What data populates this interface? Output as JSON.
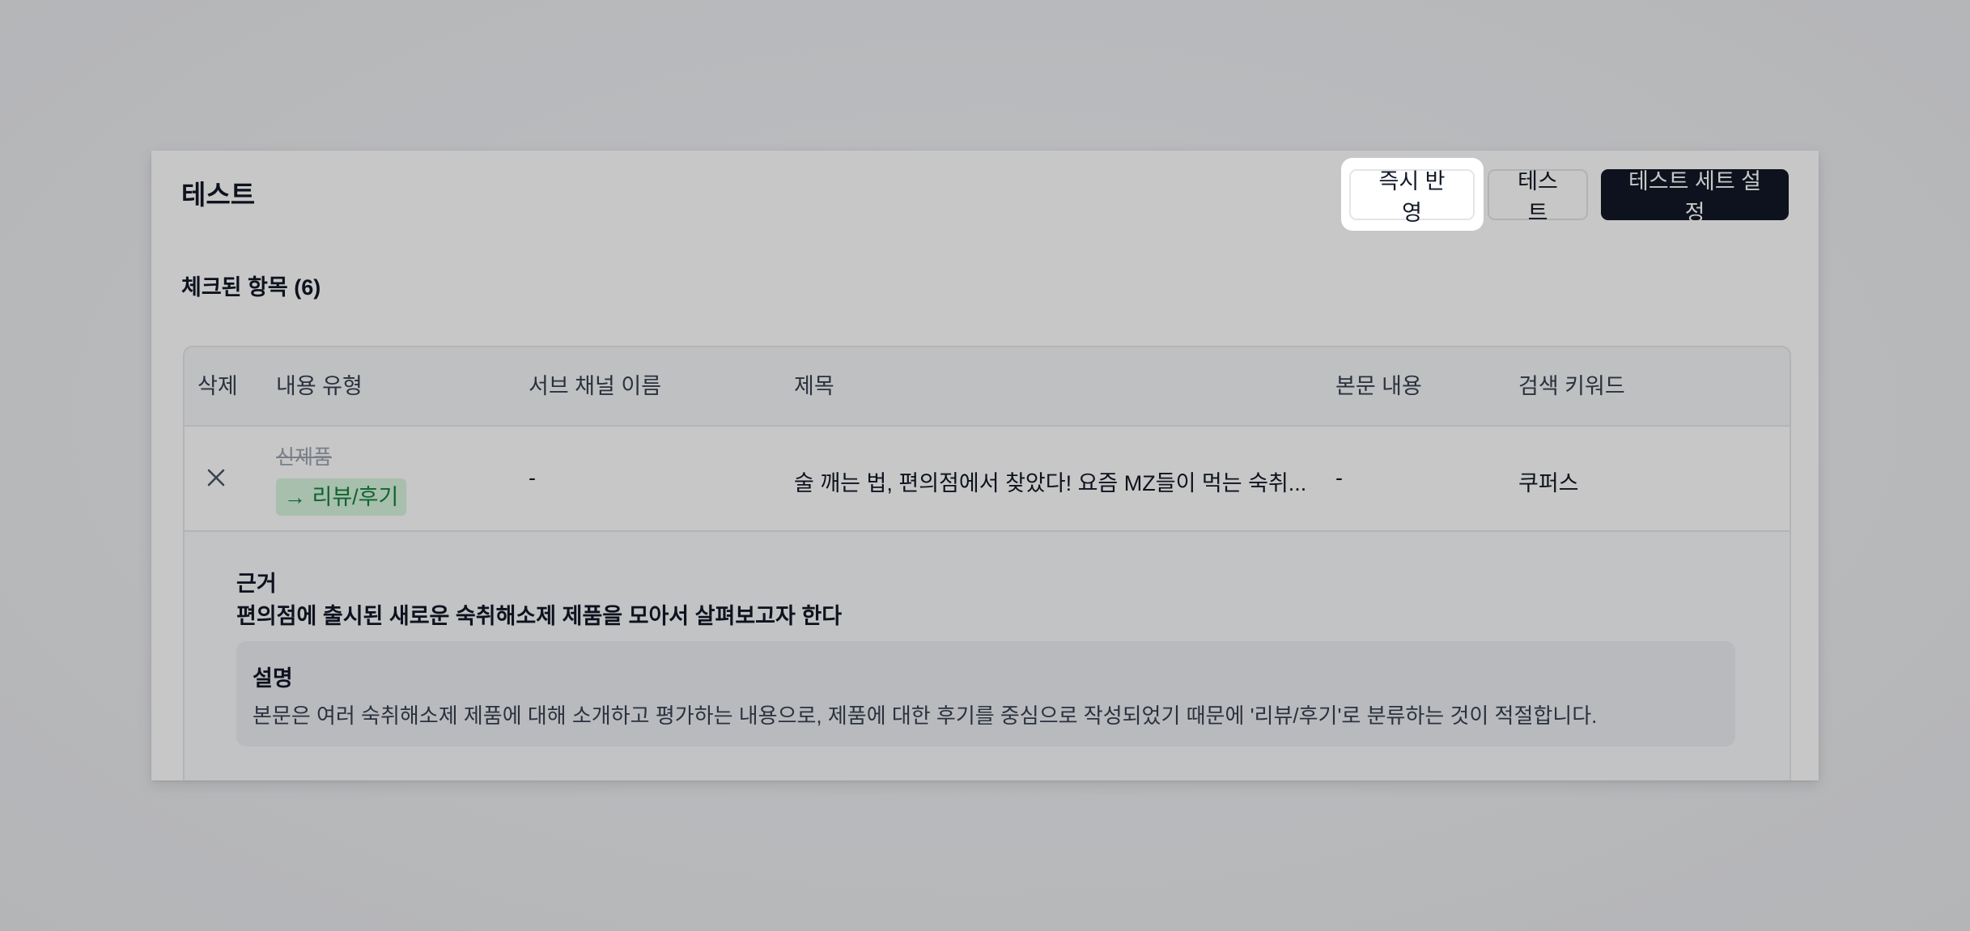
{
  "panel": {
    "title": "테스트",
    "buttons": {
      "immediate_apply": "즉시 반영",
      "test": "테스트",
      "test_set_settings": "테스트 세트 설정"
    },
    "checked_items_label": "체크된 항목",
    "checked_items_count": "(6)"
  },
  "table": {
    "columns": [
      "삭제",
      "내용 유형",
      "서브 채널 이름",
      "제목",
      "본문 내용",
      "검색 키워드"
    ],
    "rows": [
      {
        "old_content_type": "신제품",
        "new_content_type": "→ 리뷰/후기",
        "sub_channel": "-",
        "title": "술 깨는 법, 편의점에서 찾았다! 요즘 MZ들이 먹는 숙취...",
        "body": "-",
        "keyword": "쿠퍼스"
      }
    ]
  },
  "detail": {
    "reason_heading": "근거",
    "reason_text": "편의점에 출시된 새로운 숙취해소제 제품을 모아서 살펴보고자 한다",
    "description_heading": "설명",
    "description_text": "본문은 여러 숙취해소제 제품에 대해 소개하고 평가하는 내용으로, 제품에 대한 후기를 중심으로 작성되었기 때문에 '리뷰/후기'로 분류하는 것이 적절합니다."
  },
  "icons": {
    "delete": "close-icon"
  }
}
